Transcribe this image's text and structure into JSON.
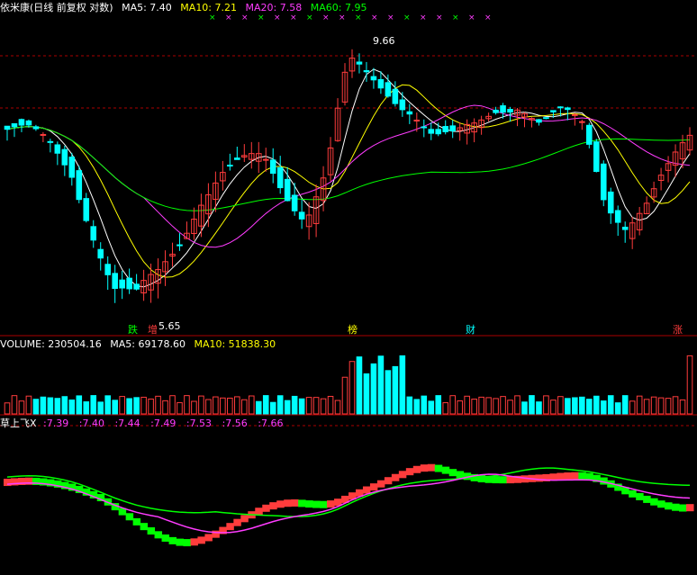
{
  "colors": {
    "up": "#ff3c3c",
    "down": "#00ffff",
    "ma5": "#ffffff",
    "ma10": "#ffff00",
    "ma20": "#ff3cff",
    "ma60": "#00ff00",
    "grid": "#aa0000",
    "label_white": "#ffffff",
    "label_yellow": "#ffff00",
    "label_magenta": "#ff3cff",
    "label_green": "#00ff00"
  },
  "header": {
    "title": "依米康(日线 前复权 对数)",
    "ma5_label": "MA5: 7.40",
    "ma10_label": "MA10: 7.21",
    "ma20_label": "MA20: 7.58",
    "ma60_label": "MA60: 7.95"
  },
  "volume_header": {
    "volume_label": "VOLUME: 230504.16",
    "ma5_label": "MA5: 69178.60",
    "ma10_label": "MA10: 51838.30"
  },
  "indicator_header": {
    "name": "草上飞X",
    "values": [
      ":7.39",
      ":7.40",
      ":7.44",
      ":7.49",
      ":7.53",
      ":7.56",
      ":7.66"
    ]
  },
  "annotations": {
    "high_label": "9.66",
    "low_label": "5.65",
    "tags": [
      {
        "text": "跌",
        "color": "#00ff00"
      },
      {
        "text": "增",
        "color": "#ff3c3c"
      },
      {
        "text": "榜",
        "color": "#ffff00"
      },
      {
        "text": "财",
        "color": "#00ffff"
      },
      {
        "text": "涨",
        "color": "#ff3c3c"
      }
    ]
  },
  "chart_data": [
    {
      "type": "candlestick",
      "title": "依米康(日线 前复权 对数)",
      "ylim": [
        5.5,
        10.2
      ],
      "scale": "log",
      "high": 9.66,
      "low": 5.65,
      "close_sequence_anchors": [
        8.2,
        8.1,
        7.9,
        7.6,
        6.8,
        6.0,
        5.8,
        6.1,
        6.6,
        7.2,
        7.5,
        7.6,
        7.7,
        7.3,
        7.0,
        7.6,
        9.3,
        9.0,
        8.8,
        8.6,
        8.1,
        8.0,
        8.2,
        8.6,
        8.7,
        8.3,
        8.4,
        8.2,
        7.2,
        6.9,
        7.1,
        7.5,
        8.0
      ],
      "ma_values_last": {
        "MA5": 7.4,
        "MA10": 7.21,
        "MA20": 7.58,
        "MA60": 7.95
      }
    },
    {
      "type": "bar",
      "title": "VOLUME",
      "last_volume": 230504.16,
      "ma5": 69178.6,
      "ma10": 51838.3
    },
    {
      "type": "line",
      "title": "草上飞X",
      "values": [
        7.39,
        7.4,
        7.44,
        7.49,
        7.53,
        7.56,
        7.66
      ]
    }
  ]
}
